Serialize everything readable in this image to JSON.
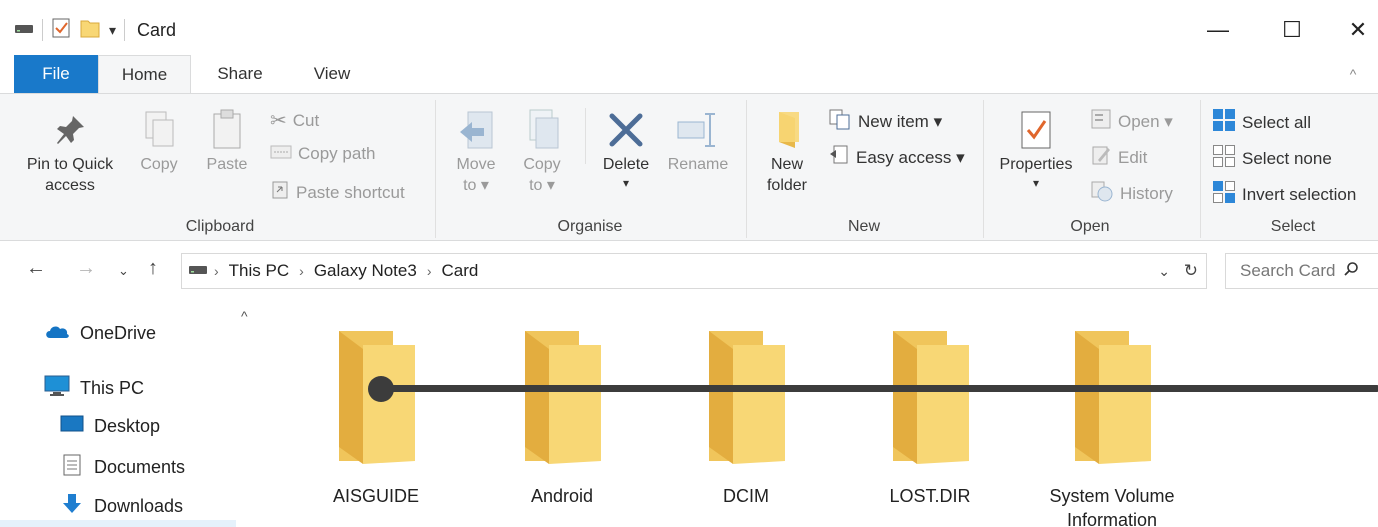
{
  "window": {
    "title": "Card",
    "minimize": "—",
    "maximize": "☐",
    "close": "✕"
  },
  "tabs": [
    {
      "label": "File"
    },
    {
      "label": "Home"
    },
    {
      "label": "Share"
    },
    {
      "label": "View"
    }
  ],
  "ribbon": {
    "clipboard": {
      "label": "Clipboard",
      "pin": "Pin to Quick access",
      "pin_line1": "Pin to Quick",
      "pin_line2": "access",
      "copy": "Copy",
      "paste": "Paste",
      "cut": "Cut",
      "copy_path": "Copy path",
      "paste_shortcut": "Paste shortcut"
    },
    "organise": {
      "label": "Organise",
      "move_to_line1": "Move",
      "move_to_line2": "to ▾",
      "copy_to_line1": "Copy",
      "copy_to_line2": "to ▾",
      "delete": "Delete",
      "delete_arrow": "▾",
      "rename": "Rename"
    },
    "new": {
      "label": "New",
      "new_folder_line1": "New",
      "new_folder_line2": "folder",
      "new_item": "New item ▾",
      "easy_access": "Easy access ▾"
    },
    "open": {
      "label": "Open",
      "properties": "Properties",
      "properties_arrow": "▾",
      "open": "Open ▾",
      "edit": "Edit",
      "history": "History"
    },
    "select": {
      "label": "Select",
      "select_all": "Select all",
      "select_none": "Select none",
      "invert_selection": "Invert selection"
    }
  },
  "address": {
    "crumbs": [
      "This PC",
      "Galaxy Note3",
      "Card"
    ],
    "search_placeholder": "Search Card"
  },
  "navpane": {
    "items": [
      {
        "label": "OneDrive"
      },
      {
        "label": "This PC"
      },
      {
        "label": "Desktop"
      },
      {
        "label": "Documents"
      },
      {
        "label": "Downloads"
      }
    ]
  },
  "folders": [
    {
      "name": "AISGUIDE"
    },
    {
      "name": "Android"
    },
    {
      "name": "DCIM"
    },
    {
      "name": "LOST.DIR"
    },
    {
      "name": "System Volume Information",
      "line1": "System Volume",
      "line2": "Information"
    }
  ],
  "colors": {
    "file_tab": "#1979ca",
    "folder_front": "#f8d775",
    "folder_back": "#e8b84a",
    "pointer": "#3c3c3c"
  }
}
